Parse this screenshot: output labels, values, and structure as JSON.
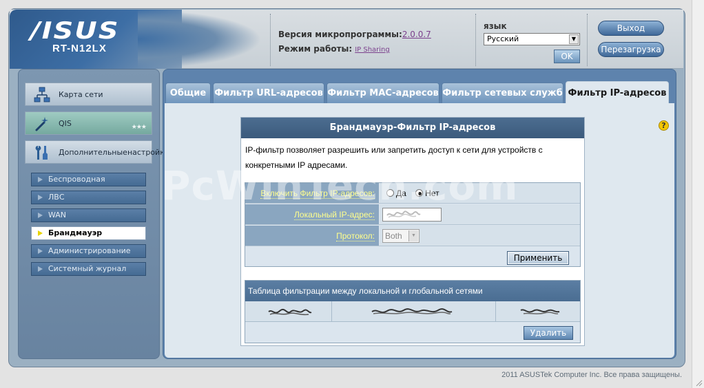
{
  "header": {
    "brand": "/ISUS",
    "model": "RT-N12LX",
    "firmware_label": "Версия микропрограммы:",
    "firmware_value": "2.0.0.7",
    "mode_label": "Режим работы:",
    "mode_value": "IP Sharing",
    "language_label": "язык",
    "language_value": "Русский",
    "ok_label": "OK",
    "logout_label": "Выход",
    "reboot_label": "Перезагрузка"
  },
  "sidebar": {
    "network_map": "Карта сети",
    "qis": "QIS",
    "advanced_line1": "Дополнительные",
    "advanced_line2": "настройки",
    "items": [
      {
        "label": "Беспроводная"
      },
      {
        "label": "ЛВС"
      },
      {
        "label": "WAN"
      },
      {
        "label": "Брандмауэр"
      },
      {
        "label": "Администрирование"
      },
      {
        "label": "Системный журнал"
      }
    ],
    "active_index": 3
  },
  "tabs": [
    {
      "label": "Общие"
    },
    {
      "label": "Фильтр URL-адресов"
    },
    {
      "label": "Фильтр MAC-адресов"
    },
    {
      "label": "Фильтр сетевых служб"
    },
    {
      "label": "Фильтр IP-адресов"
    }
  ],
  "panel": {
    "title": "Брандмауэр-Фильтр IP-адресов",
    "description": "IP-фильтр позволяет разрешить или запретить доступ к сети для устройств с конкретными IP адресами.",
    "enable_label": "Включить Фильтр IP-адресов:",
    "yes_label": "Да",
    "no_label": "Нет",
    "enabled": false,
    "local_ip_label": "Локальный IP-адрес:",
    "protocol_label": "Протокол:",
    "protocol_value": "Both",
    "apply_label": "Применить",
    "table_title": "Таблица фильтрации между локальной и глобальной сетями",
    "delete_label": "Удалить"
  },
  "watermark": "PcWinTech.com",
  "footer": "2011 ASUSTek Computer Inc. Все права защищены.",
  "colors": {
    "brand_blue": "#3d6ea5",
    "tab_active_bg": "#dfe8ef",
    "label_yellow": "#ffff8c",
    "link_purple": "#7b3f8c"
  }
}
